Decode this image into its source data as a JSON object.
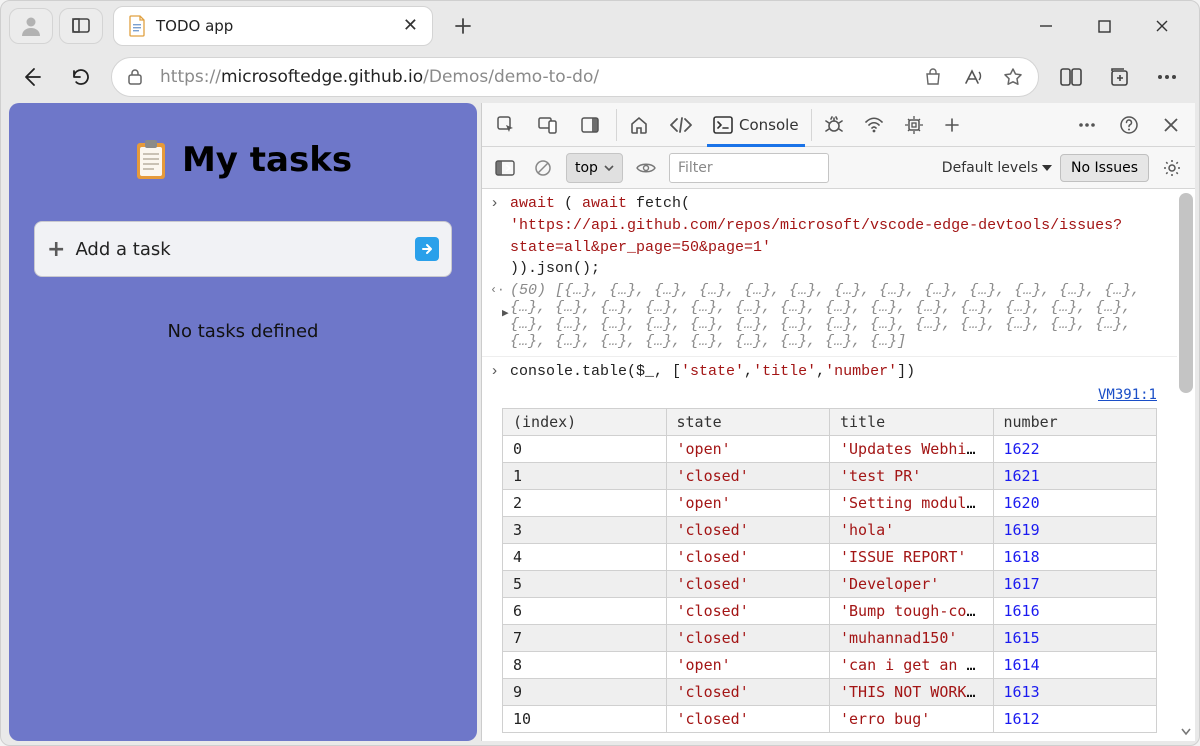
{
  "browser": {
    "tab_title": "TODO app",
    "url_host_prefix": "https://",
    "url_host": "microsoftedge.github.io",
    "url_path": "/Demos/demo-to-do/"
  },
  "todo": {
    "title": "My tasks",
    "add_placeholder": "Add a task",
    "empty_message": "No tasks defined"
  },
  "devtools": {
    "tabs": {
      "console_label": "Console"
    },
    "toolbar": {
      "context": "top",
      "filter_placeholder": "Filter",
      "levels_label": "Default levels",
      "issues_label": "No Issues"
    },
    "vm_link": "VM391:1",
    "console_lines": {
      "l1_a": "await",
      "l1_b": " ( ",
      "l1_c": "await",
      "l1_d": " fetch(",
      "l2": "'https://api.github.com/repos/microsoft/vscode-edge-devtools/issues?state=all&per_page=50&page=1'",
      "l3": ")).json();",
      "arr_preview": "(50) [{…}, {…}, {…}, {…}, {…}, {…}, {…}, {…}, {…}, {…}, {…}, {…}, {…}, {…}, {…}, {…}, {…}, {…}, {…}, {…}, {…}, {…}, {…}, {…}, {…}, {…}, {…}, {…}, {…}, {…}, {…}, {…}, {…}, {…}, {…}, {…}, {…}, {…}, {…}, {…}, {…}, {…}, {…}, {…}, {…}, {…}, {…}, {…}, {…}, {…}]",
      "l4_a": "console.table($_, [",
      "l4_b": "'state'",
      "l4_c": ",",
      "l4_d": "'title'",
      "l4_e": ",",
      "l4_f": "'number'",
      "l4_g": "])"
    },
    "table": {
      "headers": {
        "index": "(index)",
        "state": "state",
        "title": "title",
        "number": "number"
      },
      "rows": [
        {
          "index": "0",
          "state": "'open'",
          "title": "'Updates Webhin…",
          "number": "1622"
        },
        {
          "index": "1",
          "state": "'closed'",
          "title": "'test PR'",
          "number": "1621"
        },
        {
          "index": "2",
          "state": "'open'",
          "title": "'Setting module…",
          "number": "1620"
        },
        {
          "index": "3",
          "state": "'closed'",
          "title": "'hola'",
          "number": "1619"
        },
        {
          "index": "4",
          "state": "'closed'",
          "title": "'ISSUE REPORT'",
          "number": "1618"
        },
        {
          "index": "5",
          "state": "'closed'",
          "title": "'Developer'",
          "number": "1617"
        },
        {
          "index": "6",
          "state": "'closed'",
          "title": "'Bump tough-coo…",
          "number": "1616"
        },
        {
          "index": "7",
          "state": "'closed'",
          "title": "'muhannad150'",
          "number": "1615"
        },
        {
          "index": "8",
          "state": "'open'",
          "title": "'can i get an a…",
          "number": "1614"
        },
        {
          "index": "9",
          "state": "'closed'",
          "title": "'THIS NOT WORK …",
          "number": "1613"
        },
        {
          "index": "10",
          "state": "'closed'",
          "title": "'erro bug'",
          "number": "1612"
        }
      ]
    }
  }
}
